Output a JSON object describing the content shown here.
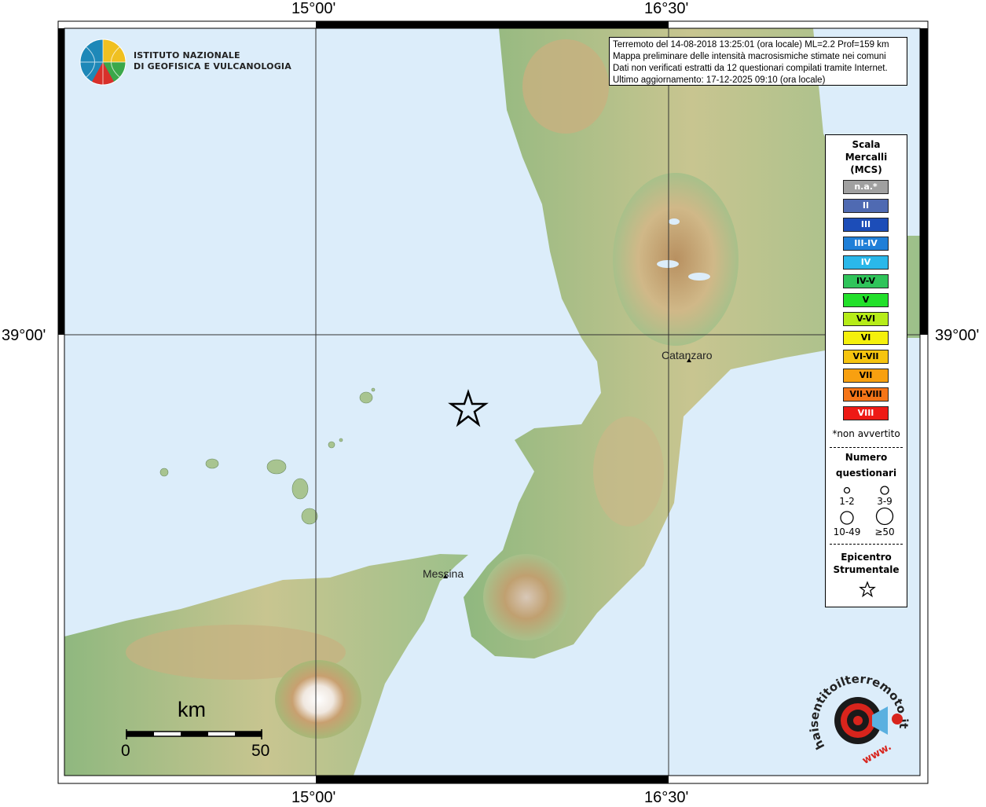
{
  "info": {
    "line1": "Terremoto del 14-08-2018 13:25:01 (ora locale) ML=2.2 Prof=159 km",
    "line2": "Mappa preliminare delle intensità macrosismiche stimate nei comuni",
    "line3": "Dati non verificati estratti da 12 questionari compilati tramite Internet.",
    "line4": "Ultimo aggiornamento: 17-12-2025 09:10 (ora locale)"
  },
  "coords": {
    "top_left_lon": "15°00'",
    "top_right_lon": "16°30'",
    "bottom_left_lon": "15°00'",
    "bottom_right_lon": "16°30'",
    "left_lat": "39°00'",
    "right_lat": "39°00'"
  },
  "institute": {
    "line1": "ISTITUTO NAZIONALE",
    "line2": "DI GEOFISICA E VULCANOLOGIA"
  },
  "cities": {
    "catanzaro": "Catanzaro",
    "messina": "Messina"
  },
  "legend": {
    "title1": "Scala",
    "title2": "Mercalli",
    "title3": "(MCS)",
    "items": [
      {
        "label": "n.a.*",
        "color": "#a0a0a0",
        "text_color": "#ffffff"
      },
      {
        "label": "II",
        "color": "#4f6ab2",
        "text_color": "#ffffff"
      },
      {
        "label": "III",
        "color": "#1c4db8",
        "text_color": "#ffffff"
      },
      {
        "label": "III-IV",
        "color": "#1f7fd8",
        "text_color": "#ffffff"
      },
      {
        "label": "IV",
        "color": "#2ab8ea",
        "text_color": "#ffffff"
      },
      {
        "label": "IV-V",
        "color": "#2fc45a",
        "text_color": "#000000"
      },
      {
        "label": "V",
        "color": "#22e02a",
        "text_color": "#000000"
      },
      {
        "label": "V-VI",
        "color": "#b6ec18",
        "text_color": "#000000"
      },
      {
        "label": "VI",
        "color": "#f4f00c",
        "text_color": "#000000"
      },
      {
        "label": "VI-VII",
        "color": "#f6c40f",
        "text_color": "#000000"
      },
      {
        "label": "VII",
        "color": "#f8a010",
        "text_color": "#000000"
      },
      {
        "label": "VII-VIII",
        "color": "#f57518",
        "text_color": "#000000"
      },
      {
        "label": "VIII",
        "color": "#ee1a15",
        "text_color": "#ffffff"
      }
    ],
    "note": "*non avvertito",
    "numero1": "Numero",
    "numero2": "questionari",
    "q1": "1-2",
    "q2": "3-9",
    "q3": "10-49",
    "q4": "≥50",
    "epi1": "Epicentro",
    "epi2": "Strumentale"
  },
  "scale": {
    "unit": "km",
    "start": "0",
    "end": "50"
  },
  "hst_logo": {
    "text": "haisentitoilterremoto.it",
    "www": "www."
  },
  "colors": {
    "sea": "#dcedfa",
    "land_low": "#9cc08a",
    "land_mid": "#d8c890",
    "land_high": "#b89868",
    "peak": "#ffffff"
  }
}
